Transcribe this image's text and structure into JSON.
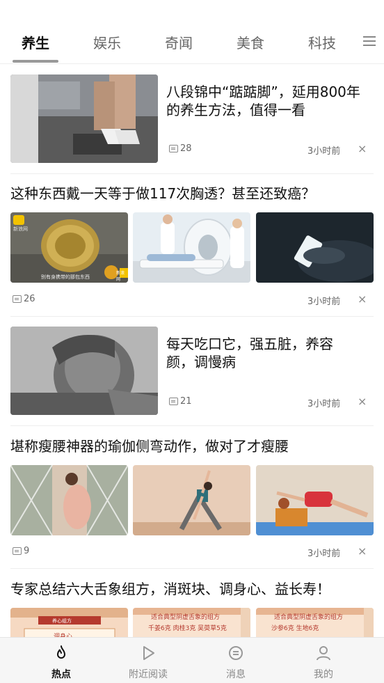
{
  "tabs": [
    "养生",
    "娱乐",
    "奇闻",
    "美食",
    "科技"
  ],
  "articles": [
    {
      "title_l1": "八段锦中“踮踮脚”，延用800年",
      "title_l2": "的养生方法，值得一看",
      "comments": "28",
      "time": "3小时前",
      "close": "×"
    },
    {
      "title": "这种东西戴一天等于做117次胸透？甚至还致癌？",
      "comments": "26",
      "time": "3小时前",
      "close": "×",
      "img1_logo": "新浪网",
      "img1_caption": "别有身携带的那包东西",
      "img1_badge": "新浪网"
    },
    {
      "title_l1": "每天吃口它，强五脏，养容",
      "title_l2": "颜，调慢病",
      "comments": "21",
      "time": "3小时前",
      "close": "×"
    },
    {
      "title": "堪称瘦腰神器的瑜伽侧弯动作，做对了才瘦腰",
      "comments": "9",
      "time": "3小时前",
      "close": "×"
    },
    {
      "title": "专家总结六大舌象组方，消斑块、调身心、益长寿！",
      "img1_title": "养心组方",
      "img1_sub": "调身心",
      "img2_title": "适合典型阴虚舌象的组方",
      "img2_sub": "千姜6克 肉桂3克 吴萸草5克",
      "img3_title": "适合典型阴虚舌象的组方",
      "img3_sub": "沙参6克 生地6克"
    }
  ],
  "bottom_nav": [
    {
      "label": "热点",
      "icon": "flame-icon"
    },
    {
      "label": "附近阅读",
      "icon": "play-icon"
    },
    {
      "label": "消息",
      "icon": "message-icon"
    },
    {
      "label": "我的",
      "icon": "user-icon"
    }
  ],
  "colors": {
    "accent": "#111111",
    "muted": "#888888",
    "divider": "#eeeeee"
  }
}
